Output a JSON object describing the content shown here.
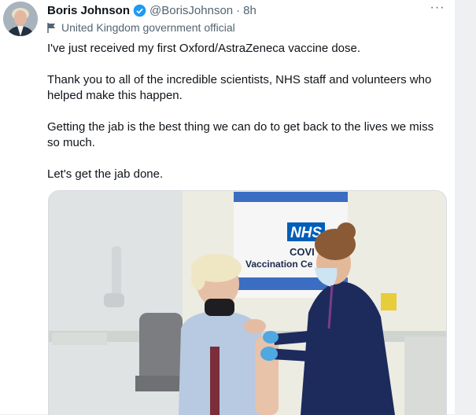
{
  "tweet": {
    "author_name": "Boris Johnson",
    "handle": "@BorisJohnson",
    "separator": "·",
    "time": "8h",
    "label": "United Kingdom government official",
    "paragraphs": [
      "I've just received my first Oxford/AstraZeneca vaccine dose.",
      "Thank you to all of the incredible scientists, NHS staff and volunteers who helped make this happen.",
      "Getting the jab is the best thing we can do to get back to the lives we miss so much.",
      "Let's get the jab done."
    ]
  },
  "media": {
    "sign_logo": "NHS",
    "sign_line1": "COVI",
    "sign_line2": "Vaccination Ce"
  },
  "icons": {
    "verified": "verified-badge-icon",
    "label": "flag-icon",
    "more": "more-icon"
  },
  "colors": {
    "verified_blue": "#1d9bf0",
    "nhs_blue": "#005eb8",
    "secondary_text": "#536471"
  }
}
